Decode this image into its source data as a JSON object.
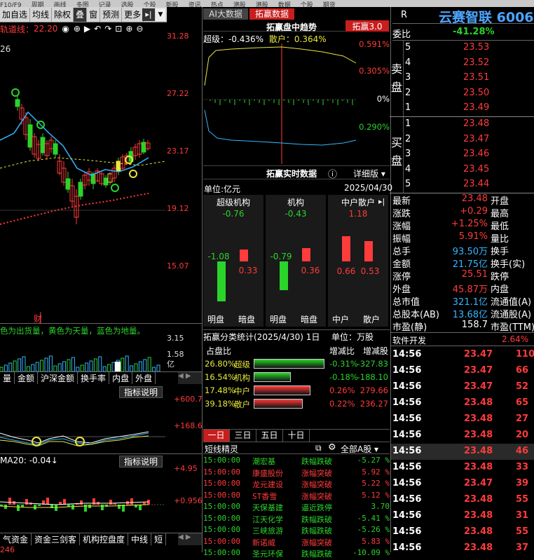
{
  "top_menu": [
    "F10/F9",
    "周期",
    "画线",
    "多图",
    "记录",
    "选股",
    "个股",
    "新股",
    "资讯",
    "热点",
    "港股",
    "港股",
    "数据",
    "个股",
    "期货"
  ],
  "toolbar": {
    "items": [
      "加自选",
      "均线",
      "除权",
      "叠",
      "窗",
      "预测",
      "更多"
    ],
    "active": "叠"
  },
  "ma_line": {
    "label": "轨道线：",
    "value": "22.20"
  },
  "chart": {
    "candle_start_label": "26",
    "y_ticks": [
      "31.28",
      "27.22",
      "23.17",
      "19.12",
      "15.07"
    ],
    "cai_label": "财"
  },
  "volume": {
    "legend": "色为出货量，黄色为天量，蓝色为地量。",
    "y_ticks": [
      "3.15",
      "1.58",
      "亿"
    ]
  },
  "indicator_tabs": [
    "量",
    "金额",
    "沪深金额",
    "换手率",
    "内盘",
    "外盘"
  ],
  "ind1": {
    "button": "指标说明",
    "ticks": [
      "+600.7",
      "+168.6"
    ]
  },
  "ind2": {
    "label": "MA20: -0.04↓",
    "button": "指标说明",
    "ticks": [
      "+4.95",
      "+0.956"
    ]
  },
  "bottom_tabs": [
    "气资金",
    "资金三剑客",
    "机构控盘度",
    "中线",
    "短"
  ],
  "bottom_value": "246",
  "mid_tabs": {
    "a": "AI大数据",
    "b": "拓赢数据"
  },
  "trend": {
    "title": "拓赢盘中趋势",
    "badge": "拓赢3.0",
    "super": "超级：-0.436%",
    "retail": "散户：0.364%",
    "ticks": [
      "0.591%",
      "0.305%",
      "0%",
      "0.290%"
    ]
  },
  "realtime": {
    "title": "拓赢实时数据",
    "detail": "详细版",
    "unit": "单位:亿元",
    "date": "2025/04/30",
    "groups": [
      {
        "name": "超级机构",
        "net": "-0.76",
        "ming": "-1.08",
        "an": "0.33",
        "l1": "明盘",
        "l2": "暗盘"
      },
      {
        "name": "机构",
        "net": "-0.43",
        "ming": "-0.79",
        "an": "0.36",
        "l1": "明盘",
        "l2": "暗盘"
      },
      {
        "name": "中户散户",
        "net": "1.18",
        "ming": "0.66",
        "an": "0.53",
        "l1": "中户",
        "l2": "散户"
      }
    ]
  },
  "classify": {
    "title": "拓赢分类统计(2025/4/30) 1日",
    "unit": "单位：万股",
    "headers": [
      "占盘比",
      "增减比",
      "增减股"
    ],
    "rows": [
      {
        "pct": "26.80%",
        "name": "超级",
        "bar": 0.95,
        "color": "#2ad42a",
        "chg": "-0.31%",
        "shares": "-327.83"
      },
      {
        "pct": "16.54%",
        "name": "机构",
        "bar": 0.5,
        "color": "#2ad42a",
        "chg": "-0.18%",
        "shares": "-188.10"
      },
      {
        "pct": "17.48%",
        "name": "中户",
        "bar": 0.76,
        "color": "#ff3b3b",
        "chg": "0.26%",
        "shares": "279.66"
      },
      {
        "pct": "39.18%",
        "name": "散户",
        "bar": 0.66,
        "color": "#ff3b3b",
        "chg": "0.22%",
        "shares": "236.27"
      }
    ]
  },
  "period_tabs": [
    "一日",
    "三日",
    "五日",
    "十日"
  ],
  "short_line": {
    "title": "短线精灵",
    "filter": "全部A股",
    "rows": [
      {
        "t": "15:00:00",
        "n": "潮宏基",
        "e": "跌幅跌破",
        "v": "-5.27 %",
        "c": "g"
      },
      {
        "t": "15:00:00",
        "n": "康盛股份",
        "e": "涨幅突破",
        "v": "5.92 %",
        "c": "r"
      },
      {
        "t": "15:00:00",
        "n": "龙元建设",
        "e": "涨幅突破",
        "v": "5.22 %",
        "c": "r"
      },
      {
        "t": "15:00:00",
        "n": "ST香雪",
        "e": "涨幅突破",
        "v": "5.12 %",
        "c": "r"
      },
      {
        "t": "15:00:00",
        "n": "天保基建",
        "e": "逼近跌停",
        "v": "3.70",
        "c": "g"
      },
      {
        "t": "15:00:00",
        "n": "江天化学",
        "e": "跌幅跌破",
        "v": "-5.41 %",
        "c": "g"
      },
      {
        "t": "15:00:00",
        "n": "三峡旅游",
        "e": "跌幅跌破",
        "v": "-5.26 %",
        "c": "g"
      },
      {
        "t": "15:00:00",
        "n": "新诺威",
        "e": "涨幅突破",
        "v": "5.83 %",
        "c": "r"
      },
      {
        "t": "15:00:00",
        "n": "圣元环保",
        "e": "跌幅跌破",
        "v": "-10.09 %",
        "c": "g"
      }
    ]
  },
  "stock": {
    "badge": "R",
    "name": "云赛智联",
    "code": "6006",
    "ratio_label": "委比",
    "ratio": "-41.28%"
  },
  "sell": [
    {
      "l": "5",
      "p": "23.53"
    },
    {
      "l": "4",
      "p": "23.52"
    },
    {
      "l": "3",
      "p": "23.51"
    },
    {
      "l": "2",
      "p": "23.50"
    },
    {
      "l": "1",
      "p": "23.49"
    }
  ],
  "sell_label": "卖盘",
  "buy_label": "买盘",
  "buy": [
    {
      "l": "1",
      "p": "23.48"
    },
    {
      "l": "2",
      "p": "23.47"
    },
    {
      "l": "3",
      "p": "23.46"
    },
    {
      "l": "4",
      "p": "23.45"
    },
    {
      "l": "5",
      "p": "23.44"
    }
  ],
  "quote": [
    {
      "k": "最新",
      "v": "23.48",
      "c": "r",
      "k2": "开盘"
    },
    {
      "k": "涨跌",
      "v": "+0.29",
      "c": "r",
      "k2": "最高"
    },
    {
      "k": "涨幅",
      "v": "+1.25%",
      "c": "r",
      "k2": "最低"
    },
    {
      "k": "振幅",
      "v": "5.91%",
      "c": "r",
      "k2": "量比"
    },
    {
      "k": "总手",
      "v": "93.50万",
      "c": "c",
      "k2": "换手"
    },
    {
      "k": "金额",
      "v": "21.75亿",
      "c": "c",
      "k2": "换手(实)"
    },
    {
      "k": "涨停",
      "v": "25.51",
      "c": "r",
      "k2": "跌停"
    },
    {
      "k": "外盘",
      "v": "45.87万",
      "c": "r",
      "k2": "内盘"
    },
    {
      "k": "总市值",
      "v": "321.1亿",
      "c": "c",
      "k2": "流通值(A)"
    },
    {
      "k": "总股本(AB)",
      "v": "13.68亿",
      "c": "c",
      "k2": "流通股(A)"
    },
    {
      "k": "市盈(静)",
      "v": "158.7",
      "c": "w",
      "k2": "市盈(TTM)"
    }
  ],
  "sector": {
    "name": "软件开发",
    "pct": "2.64%"
  },
  "ticks": [
    {
      "t": "14:56",
      "p": "23.47",
      "v": "110"
    },
    {
      "t": "14:56",
      "p": "23.47",
      "v": "66"
    },
    {
      "t": "14:56",
      "p": "23.47",
      "v": "52"
    },
    {
      "t": "14:56",
      "p": "23.48",
      "v": "65"
    },
    {
      "t": "14:56",
      "p": "23.48",
      "v": "27"
    },
    {
      "t": "14:56",
      "p": "23.48",
      "v": "20"
    },
    {
      "t": "14:56",
      "p": "23.48",
      "v": "46"
    },
    {
      "t": "14:56",
      "p": "23.48",
      "v": "33"
    },
    {
      "t": "14:56",
      "p": "23.47",
      "v": "39"
    },
    {
      "t": "14:56",
      "p": "23.48",
      "v": "55"
    },
    {
      "t": "14:56",
      "p": "23.48",
      "v": "31"
    },
    {
      "t": "14:56",
      "p": "23.48",
      "v": "55"
    },
    {
      "t": "14:56",
      "p": "23.48",
      "v": "37"
    }
  ]
}
